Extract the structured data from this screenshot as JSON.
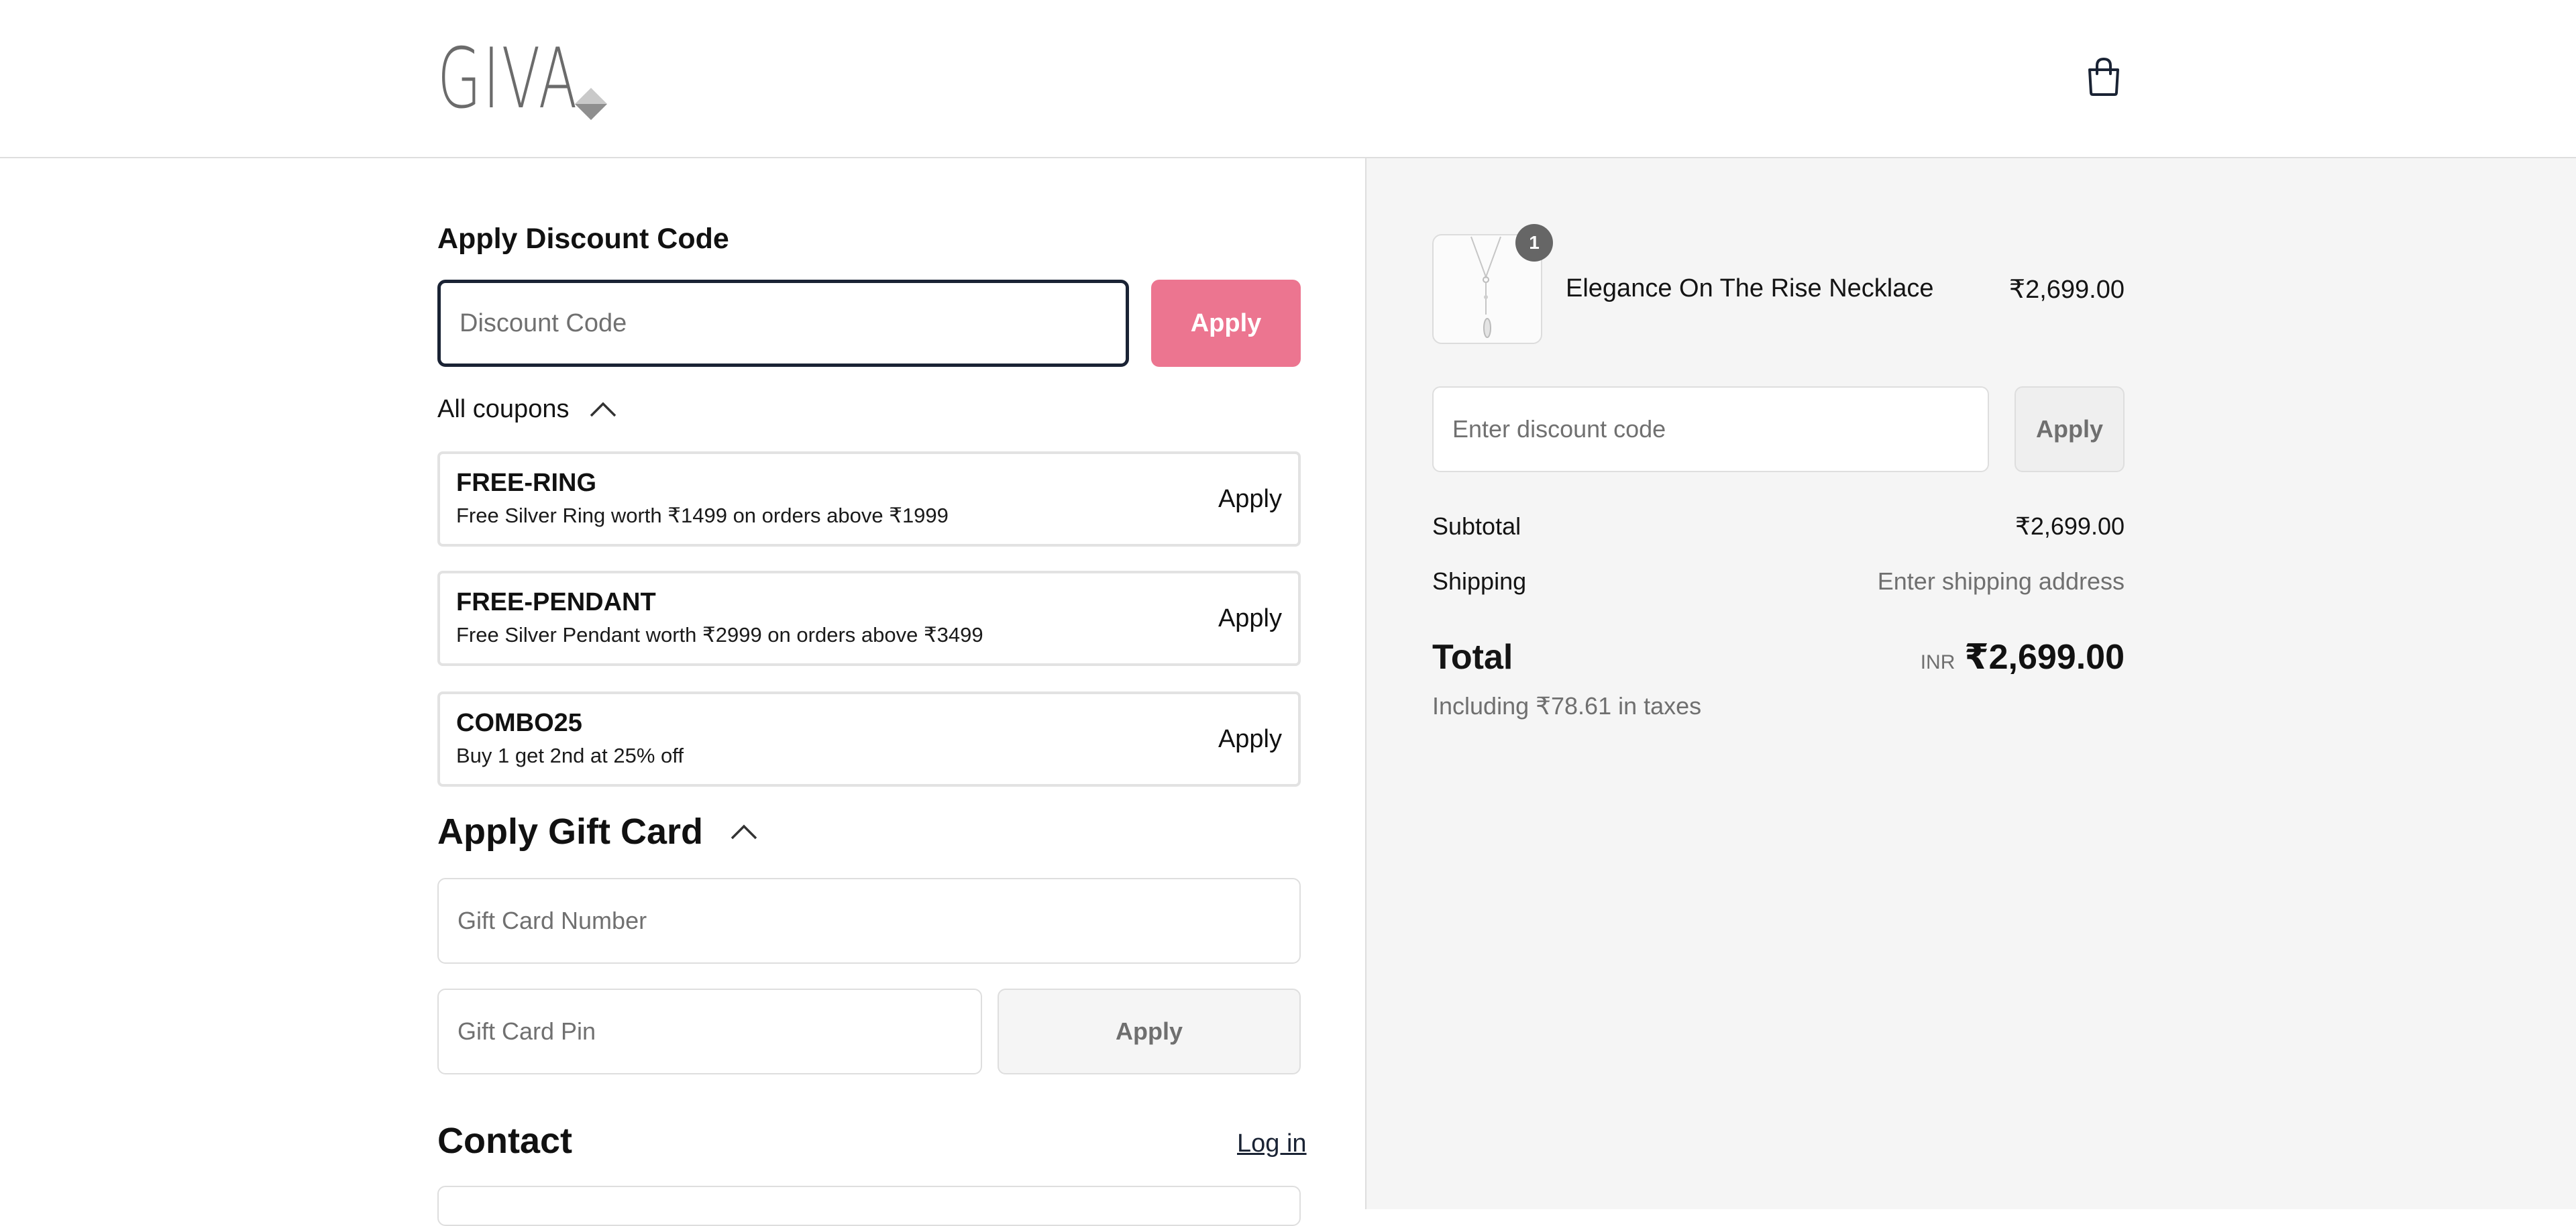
{
  "header": {
    "logo_text": "GIVA",
    "cart_icon": "shopping-bag-icon"
  },
  "discount": {
    "title": "Apply Discount Code",
    "placeholder": "Discount Code",
    "apply_label": "Apply",
    "all_coupons_label": "All coupons",
    "coupons": [
      {
        "code": "FREE-RING",
        "description": "Free Silver Ring worth ₹1499 on orders above ₹1999",
        "apply_label": "Apply"
      },
      {
        "code": "FREE-PENDANT",
        "description": "Free Silver Pendant worth ₹2999 on orders above ₹3499",
        "apply_label": "Apply"
      },
      {
        "code": "COMBO25",
        "description": "Buy 1 get 2nd at 25% off",
        "apply_label": "Apply"
      }
    ]
  },
  "gift_card": {
    "title": "Apply Gift Card",
    "number_placeholder": "Gift Card Number",
    "pin_placeholder": "Gift Card Pin",
    "apply_label": "Apply"
  },
  "contact": {
    "title": "Contact",
    "login_label": "Log in"
  },
  "summary": {
    "item": {
      "name": "Elegance On The Rise Necklace",
      "price": "₹2,699.00",
      "quantity": "1"
    },
    "discount_placeholder": "Enter discount code",
    "discount_apply_label": "Apply",
    "subtotal_label": "Subtotal",
    "subtotal_value": "₹2,699.00",
    "shipping_label": "Shipping",
    "shipping_value": "Enter shipping address",
    "total_label": "Total",
    "currency": "INR",
    "total_value": "₹2,699.00",
    "taxes_note": "Including ₹78.61 in taxes"
  },
  "colors": {
    "accent_pink": "#ec7590",
    "focus_border": "#1a2334",
    "panel_bg": "#f5f5f5"
  }
}
